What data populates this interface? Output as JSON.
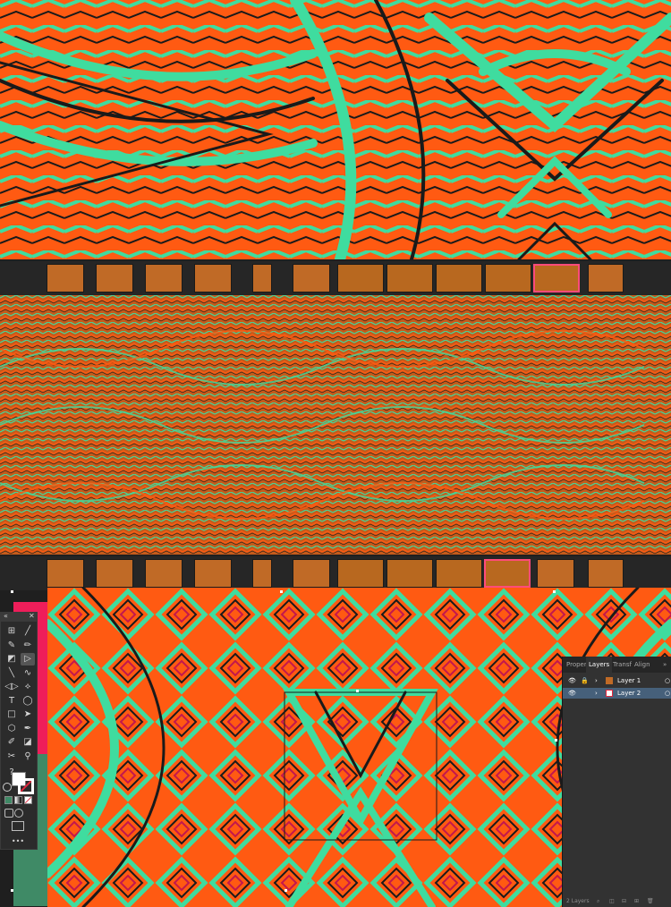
{
  "colors": {
    "orange": "#ff5a12",
    "mint": "#3fdc9f",
    "dark": "#1a1a1a",
    "pink_accent": "#ee1e5a",
    "green_accent": "#3f8a66",
    "panel_bg": "#323232",
    "selection": "#ff4b7a"
  },
  "toolbar": {
    "collapse_glyph": "«",
    "close_glyph": "✕",
    "tools": [
      {
        "name": "artboard-tool-icon",
        "glyph": "⊞"
      },
      {
        "name": "paintbrush-tool-icon",
        "glyph": "╱"
      },
      {
        "name": "shaper-tool-icon",
        "glyph": "✎"
      },
      {
        "name": "pencil-tool-icon",
        "glyph": "✏"
      },
      {
        "name": "eraser-tool-icon",
        "glyph": "◩"
      },
      {
        "name": "direct-selection-tool-icon",
        "glyph": "▷"
      },
      {
        "name": "line-tool-icon",
        "glyph": "╲"
      },
      {
        "name": "lasso-tool-icon",
        "glyph": "∿"
      },
      {
        "name": "reflect-tool-icon",
        "glyph": "◁▷"
      },
      {
        "name": "width-tool-icon",
        "glyph": "⟡"
      },
      {
        "name": "type-tool-icon",
        "glyph": "T"
      },
      {
        "name": "ellipse-tool-icon",
        "glyph": "◯"
      },
      {
        "name": "rectangle-tool-icon",
        "glyph": "□"
      },
      {
        "name": "selection-tool-icon",
        "glyph": "➤"
      },
      {
        "name": "polygon-tool-icon",
        "glyph": "⬡"
      },
      {
        "name": "pen-tool-icon",
        "glyph": "✒"
      },
      {
        "name": "blob-brush-tool-icon",
        "glyph": "✐"
      },
      {
        "name": "gradient-tool-icon",
        "glyph": "◪"
      },
      {
        "name": "scissors-tool-icon",
        "glyph": "✂"
      },
      {
        "name": "zoom-tool-icon",
        "glyph": "⚲"
      }
    ],
    "help_glyph": "?",
    "more_glyph": "•••"
  },
  "layers_panel": {
    "tabs": [
      "Proper",
      "Layers",
      "Transf",
      "Align"
    ],
    "overflow_glyph": "»",
    "layers": [
      {
        "name": "Layer 1",
        "selected": false
      },
      {
        "name": "Layer 2",
        "selected": true
      }
    ],
    "footer_text": "2 Layers"
  }
}
